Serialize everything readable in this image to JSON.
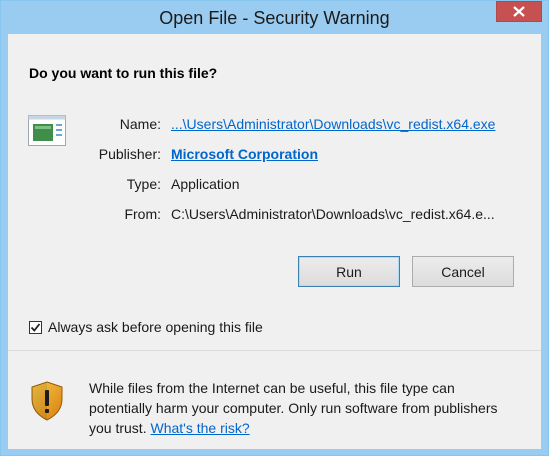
{
  "window": {
    "title": "Open File - Security Warning",
    "close_label": "X"
  },
  "dialog": {
    "question": "Do you want to run this file?",
    "fields": {
      "name_label": "Name:",
      "name_value": "...\\Users\\Administrator\\Downloads\\vc_redist.x64.exe",
      "publisher_label": "Publisher:",
      "publisher_value": "Microsoft Corporation",
      "type_label": "Type:",
      "type_value": "Application",
      "from_label": "From:",
      "from_value": "C:\\Users\\Administrator\\Downloads\\vc_redist.x64.e..."
    },
    "buttons": {
      "run_label": "Run",
      "cancel_label": "Cancel"
    },
    "checkbox": {
      "label": "Always ask before opening this file",
      "checked": true
    }
  },
  "footer": {
    "warning_text": "While files from the Internet can be useful, this file type can potentially harm your computer. Only run software from publishers you trust.",
    "risk_link": "What's the risk?"
  },
  "icons": {
    "file": "executable-file-icon",
    "shield": "security-shield-warning-icon",
    "check": "checkmark-icon",
    "close": "close-icon"
  },
  "colors": {
    "title_bar": "#99ccf0",
    "close_button": "#c75050",
    "link": "#0066cc",
    "background": "#f0f0f0"
  }
}
